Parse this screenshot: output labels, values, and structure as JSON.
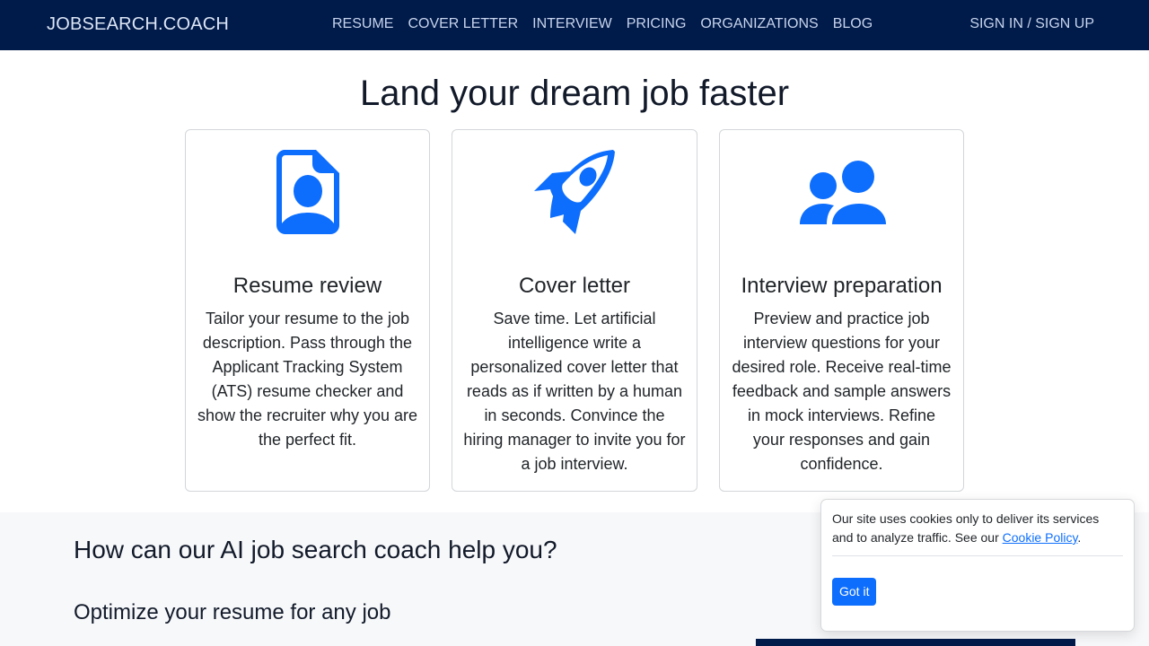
{
  "nav": {
    "brand": "JOBSEARCH.COACH",
    "links": [
      "RESUME",
      "COVER LETTER",
      "INTERVIEW",
      "PRICING",
      "ORGANIZATIONS",
      "BLOG"
    ],
    "signin": "SIGN IN / SIGN UP"
  },
  "hero": {
    "title": "Land your dream job faster"
  },
  "cards": [
    {
      "icon": "person-document-icon",
      "title": "Resume review",
      "text": "Tailor your resume to the job description. Pass through the Applicant Tracking System (ATS) resume checker and show the recruiter why you are the perfect fit."
    },
    {
      "icon": "rocket-icon",
      "title": "Cover letter",
      "text": "Save time. Let artificial intelligence write a personalized cover letter that reads as if written by a human in seconds. Convince the hiring manager to invite you for a job interview."
    },
    {
      "icon": "people-icon",
      "title": "Interview preparation",
      "text": "Preview and practice job interview questions for your desired role. Receive real-time feedback and sample answers in mock interviews. Refine your responses and gain confidence."
    }
  ],
  "section2": {
    "heading": "How can our AI job search coach help you?",
    "subheading": "Optimize your resume for any job"
  },
  "cookie": {
    "text_before": "Our site uses cookies only to deliver its services and to analyze traffic. See our ",
    "link": "Cookie Policy",
    "text_after": ".",
    "button": "Got it"
  },
  "colors": {
    "navbar": "#001a4a",
    "accent": "#0d6efd"
  }
}
